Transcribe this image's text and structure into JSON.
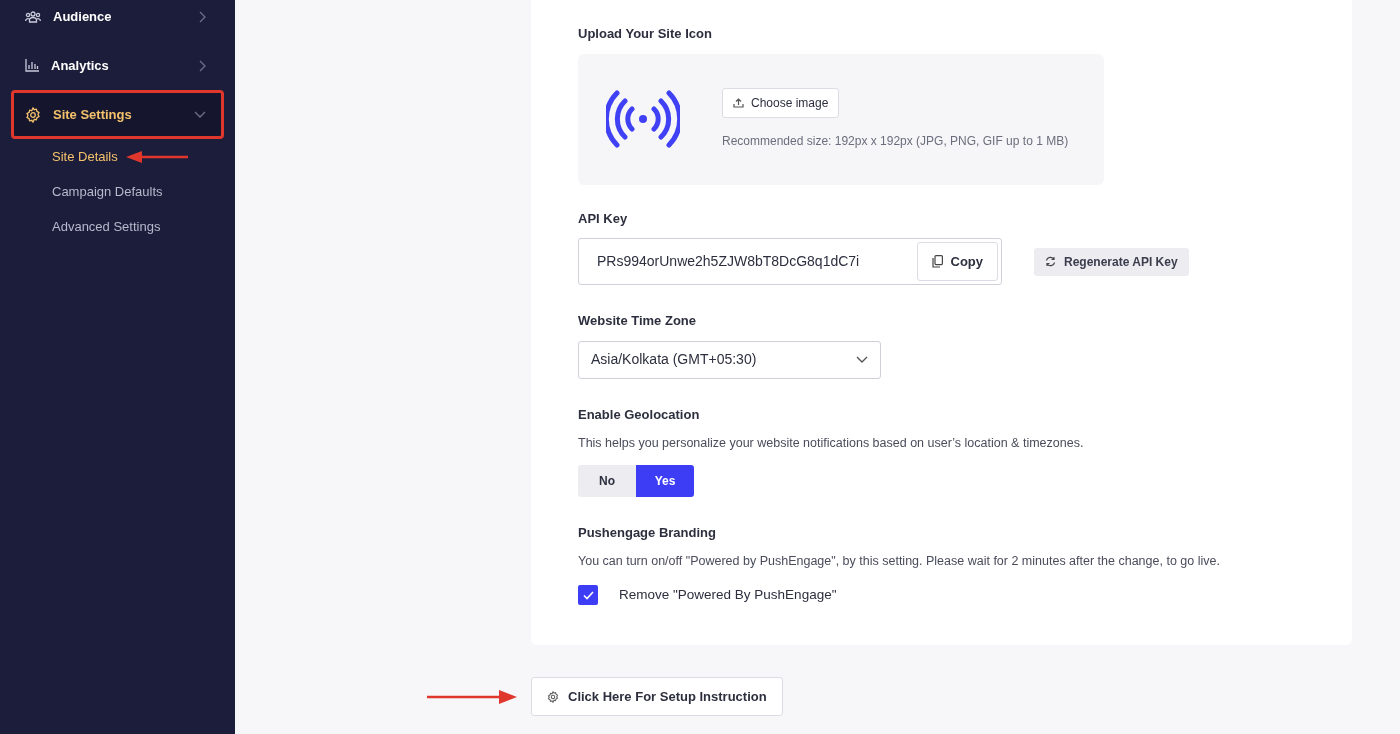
{
  "sidebar": {
    "items": [
      {
        "label": "Audience",
        "expanded": false,
        "selected": false,
        "highlighted": false
      },
      {
        "label": "Analytics",
        "expanded": false,
        "selected": false,
        "highlighted": false
      },
      {
        "label": "Site Settings",
        "expanded": true,
        "selected": true,
        "highlighted": true,
        "children": [
          {
            "label": "Site Details",
            "selected": true,
            "annotated": true
          },
          {
            "label": "Campaign Defaults",
            "selected": false,
            "annotated": false
          },
          {
            "label": "Advanced Settings",
            "selected": false,
            "annotated": false
          }
        ]
      }
    ]
  },
  "site_icon": {
    "label": "Upload Your Site Icon",
    "button": "Choose image",
    "hint": "Recommended size: 192px x 192px (JPG, PNG, GIF up to 1 MB)"
  },
  "api_key": {
    "label": "API Key",
    "value": "PRs994orUnwe2h5ZJW8bT8DcG8q1dC7i",
    "copy_button": "Copy",
    "regenerate_button": "Regenerate API Key"
  },
  "time_zone": {
    "label": "Website Time Zone",
    "value": "Asia/Kolkata (GMT+05:30)"
  },
  "geolocation": {
    "label": "Enable Geolocation",
    "description": "This helps you personalize your website notifications based on user’s location & timezones.",
    "options": [
      {
        "label": "No",
        "selected": false
      },
      {
        "label": "Yes",
        "selected": true
      }
    ]
  },
  "branding": {
    "label": "Pushengage Branding",
    "description": "You can turn on/off \"Powered by PushEngage\", by this setting. Please wait for 2 minutes after the change, to go live.",
    "checkbox": {
      "label": "Remove \"Powered By PushEngage\"",
      "checked": true
    }
  },
  "setup_button": {
    "label": "Click Here For Setup Instruction",
    "annotated": true
  }
}
